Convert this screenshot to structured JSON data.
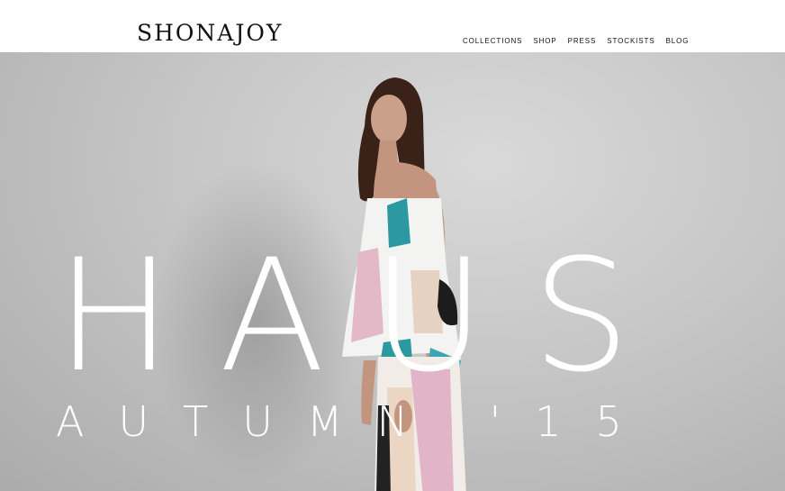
{
  "brand": {
    "logo_text": "SHONAJOY"
  },
  "nav": {
    "items": [
      {
        "label": "COLLECTIONS"
      },
      {
        "label": "SHOP"
      },
      {
        "label": "PRESS"
      },
      {
        "label": "STOCKISTS"
      },
      {
        "label": "BLOG"
      }
    ]
  },
  "hero": {
    "title": "HAUS",
    "subtitle": "AUTUMN '15",
    "image_description_icon": "fashion-model-image"
  },
  "colors": {
    "background": "#ffffff",
    "text": "#111111",
    "hero_gray": "#c6c6c6",
    "title_white": "#ffffff"
  }
}
